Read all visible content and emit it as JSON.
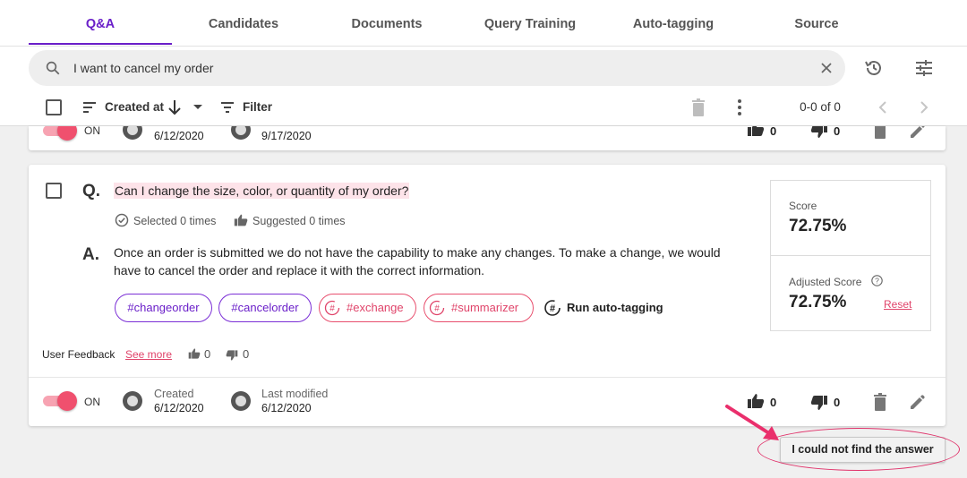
{
  "tabs": [
    {
      "label": "Q&A",
      "active": true
    },
    {
      "label": "Candidates"
    },
    {
      "label": "Documents"
    },
    {
      "label": "Query Training"
    },
    {
      "label": "Auto-tagging"
    },
    {
      "label": "Source"
    }
  ],
  "search": {
    "value": "I want to cancel my order"
  },
  "toolbar": {
    "sort_label": "Created at",
    "filter_label": "Filter",
    "pagination": "0-0 of 0"
  },
  "prev_card": {
    "toggle": "ON",
    "created_date": "6/12/2020",
    "modified_date": "9/17/2020",
    "likes": "0",
    "dislikes": "0"
  },
  "card": {
    "question": "Can I change the size, color, or quantity of my order?",
    "selected": "Selected 0 times",
    "suggested": "Suggested 0 times",
    "answer": "Once an order is submitted we do not have the capability to make any changes. To make a change, we would have to cancel the order and replace it with the correct information.",
    "tags": [
      {
        "label": "#changeorder",
        "style": "purple"
      },
      {
        "label": "#cancelorder",
        "style": "purple"
      },
      {
        "label": "#exchange",
        "style": "pink"
      },
      {
        "label": "#summarizer",
        "style": "pink"
      }
    ],
    "run_autotagging": "Run auto-tagging",
    "feedback_label": "User Feedback",
    "see_more": "See more",
    "feedback_likes": "0",
    "feedback_dislikes": "0",
    "score_label": "Score",
    "score_value": "72.75%",
    "adjusted_label": "Adjusted Score",
    "adjusted_value": "72.75%",
    "reset": "Reset",
    "toggle": "ON",
    "created_label": "Created",
    "created_date": "6/12/2020",
    "modified_label": "Last modified",
    "modified_date": "6/12/2020",
    "likes": "0",
    "dislikes": "0"
  },
  "not_found_button": "I could not find the answer",
  "colors": {
    "accent": "#6a1fc9",
    "pink": "#e0446a",
    "toggle": "#f0506e"
  }
}
